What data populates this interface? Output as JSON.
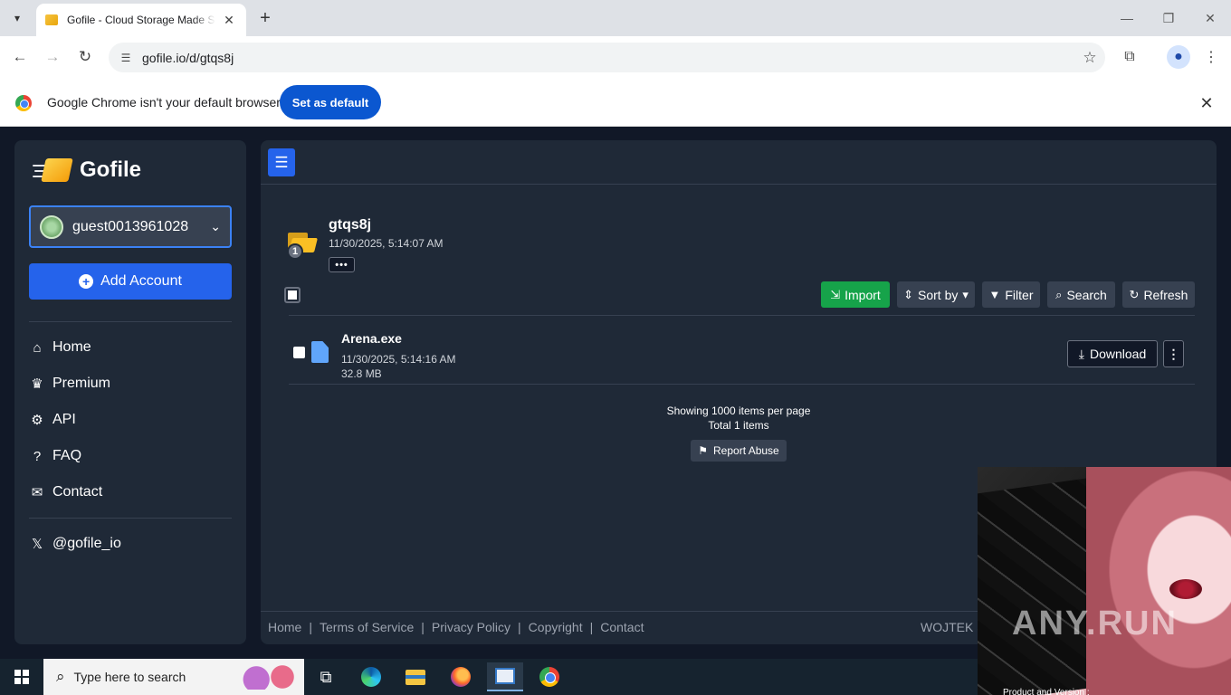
{
  "browser": {
    "tab_title": "Gofile - Cloud Storage Made Si",
    "url": "gofile.io/d/gtqs8j",
    "infobar_text": "Google Chrome isn't your default browser",
    "set_default_label": "Set as default"
  },
  "sidebar": {
    "logo_text": "Gofile",
    "account_name": "guest0013961028",
    "add_account_label": "Add Account",
    "nav": [
      {
        "label": "Home",
        "icon": "home-icon"
      },
      {
        "label": "Premium",
        "icon": "crown-icon"
      },
      {
        "label": "API",
        "icon": "cogs-icon"
      },
      {
        "label": "FAQ",
        "icon": "question-icon"
      },
      {
        "label": "Contact",
        "icon": "envelope-icon"
      }
    ],
    "social_label": "@gofile_io"
  },
  "folder": {
    "name": "gtqs8j",
    "date": "11/30/2025, 5:14:07 AM",
    "badge_count": "1",
    "more_label": "•••"
  },
  "actions": {
    "import_label": "Import",
    "sort_label": "Sort by",
    "filter_label": "Filter",
    "search_label": "Search",
    "refresh_label": "Refresh"
  },
  "files": [
    {
      "name": "Arena.exe",
      "date": "11/30/2025, 5:14:16 AM",
      "size": "32.8 MB",
      "download_label": "Download"
    }
  ],
  "listing": {
    "per_page_text": "Showing 1000 items per page",
    "total_text": "Total 1 items",
    "report_label": "Report Abuse"
  },
  "footer": {
    "links": [
      "Home",
      "Terms of Service",
      "Privacy Policy",
      "Copyright",
      "Contact"
    ],
    "right_text": "WOJTEK S"
  },
  "overlay": {
    "watermark": "ANY.RUN",
    "caption": "Product and Version :"
  },
  "taskbar": {
    "search_placeholder": "Type here to search"
  },
  "colors": {
    "page_bg": "#111827",
    "panel_bg": "#1f2937",
    "primary": "#2563eb",
    "import_green": "#16a34a",
    "chrome_blue": "#0b57d0"
  }
}
